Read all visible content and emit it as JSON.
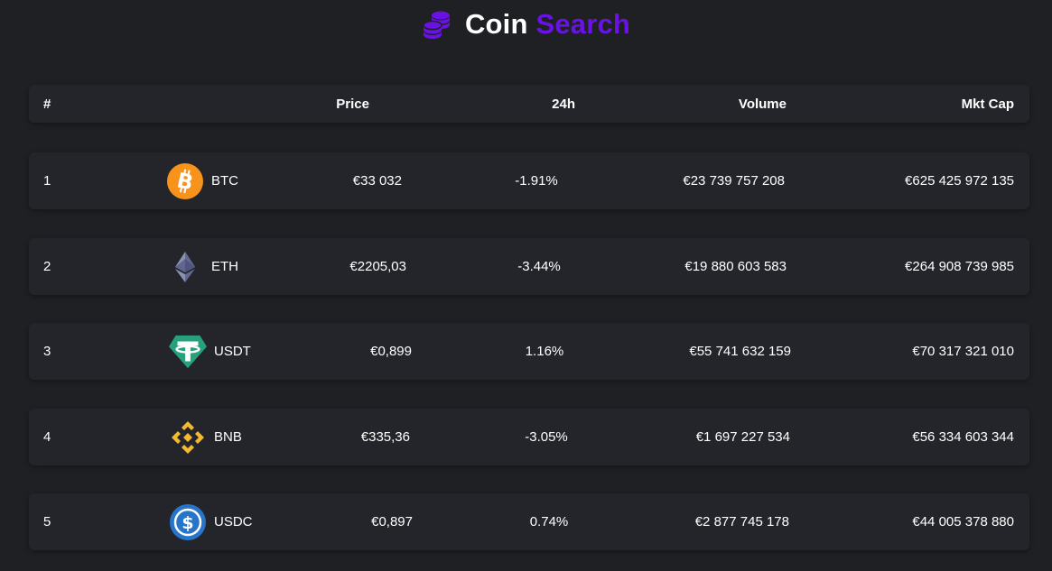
{
  "header": {
    "title_part1": "Coin",
    "title_part2": "Search",
    "icon": "coins-stack-icon",
    "accent_color": "#6a12e6"
  },
  "table": {
    "columns": {
      "rank": "#",
      "price": "Price",
      "change": "24h",
      "volume": "Volume",
      "market_cap": "Mkt Cap"
    },
    "rows": [
      {
        "rank": "1",
        "symbol": "BTC",
        "price": "€33 032",
        "change": "-1.91%",
        "volume": "€23 739 757 208",
        "market_cap": "€625 425 972 135",
        "icon": "bitcoin-icon"
      },
      {
        "rank": "2",
        "symbol": "ETH",
        "price": "€2205,03",
        "change": "-3.44%",
        "volume": "€19 880 603 583",
        "market_cap": "€264 908 739 985",
        "icon": "ethereum-icon"
      },
      {
        "rank": "3",
        "symbol": "USDT",
        "price": "€0,899",
        "change": "1.16%",
        "volume": "€55 741 632 159",
        "market_cap": "€70 317 321 010",
        "icon": "tether-icon"
      },
      {
        "rank": "4",
        "symbol": "BNB",
        "price": "€335,36",
        "change": "-3.05%",
        "volume": "€1 697 227 534",
        "market_cap": "€56 334 603 344",
        "icon": "bnb-icon"
      },
      {
        "rank": "5",
        "symbol": "USDC",
        "price": "€0,897",
        "change": "0.74%",
        "volume": "€2 877 745 178",
        "market_cap": "€44 005 378 880",
        "icon": "usdc-icon"
      }
    ]
  },
  "colors": {
    "background": "#1f2024",
    "card": "#23252b",
    "bitcoin": "#f7931a",
    "tether": "#26a17b",
    "bnb": "#f3ba2f",
    "usdc": "#2775ca"
  }
}
